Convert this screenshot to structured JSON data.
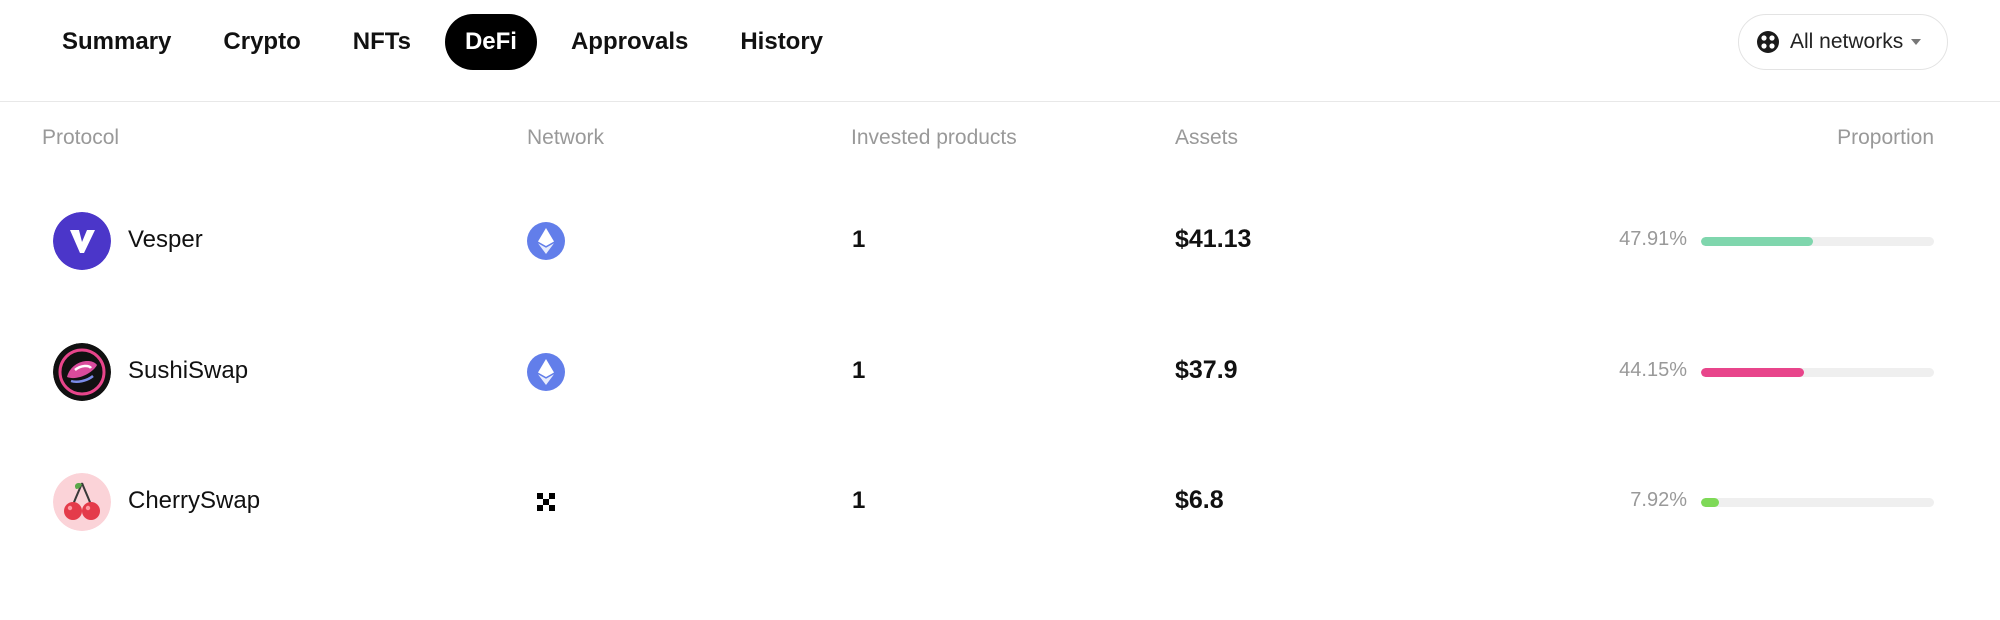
{
  "tabs": [
    {
      "label": "Summary",
      "active": false
    },
    {
      "label": "Crypto",
      "active": false
    },
    {
      "label": "NFTs",
      "active": false
    },
    {
      "label": "DeFi",
      "active": true
    },
    {
      "label": "Approvals",
      "active": false
    },
    {
      "label": "History",
      "active": false
    }
  ],
  "network_filter": {
    "label": "All networks",
    "icon": "globe-icon"
  },
  "table": {
    "headers": {
      "protocol": "Protocol",
      "network": "Network",
      "products": "Invested products",
      "assets": "Assets",
      "proportion": "Proportion"
    },
    "rows": [
      {
        "protocol": "Vesper",
        "logo": "vesper-logo",
        "network_icon": "ethereum-icon",
        "products": "1",
        "assets": "$41.13",
        "proportion_label": "47.91%",
        "proportion": 0.4791,
        "bar_color": "#7fd6ad"
      },
      {
        "protocol": "SushiSwap",
        "logo": "sushiswap-logo",
        "network_icon": "ethereum-icon",
        "products": "1",
        "assets": "$37.9",
        "proportion_label": "44.15%",
        "proportion": 0.4415,
        "bar_color": "#e8458b"
      },
      {
        "protocol": "CherrySwap",
        "logo": "cherryswap-logo",
        "network_icon": "okx-chain-icon",
        "products": "1",
        "assets": "$6.8",
        "proportion_label": "7.92%",
        "proportion": 0.0792,
        "bar_color": "#7ed957"
      }
    ]
  },
  "colors": {
    "active_tab_bg": "#000000",
    "ethereum": "#627eea",
    "vesper": "#4b36c9"
  }
}
